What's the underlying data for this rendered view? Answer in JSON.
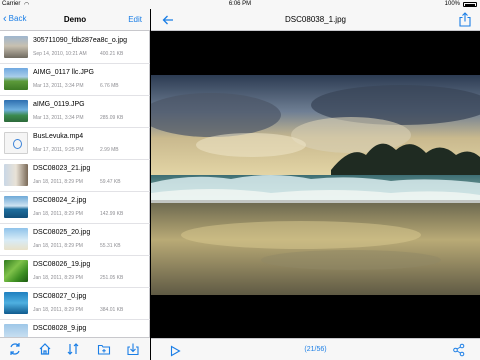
{
  "status": {
    "carrier": "Carrier",
    "time": "6:06 PM",
    "battery": "100%"
  },
  "left_nav": {
    "back_label": "Back",
    "title": "Demo",
    "edit_label": "Edit"
  },
  "files": [
    {
      "name": "305711090_fdb287ea8c_o.jpg",
      "date": "Sep 14, 2010, 10:21 AM",
      "size": "400.21 KB",
      "thumb": "photo-city"
    },
    {
      "name": "AIMG_0117 llc.JPG",
      "date": "Mar 13, 2011, 3:34 PM",
      "size": "6.76 MB",
      "thumb": "photo-field"
    },
    {
      "name": "aIMG_0119.JPG",
      "date": "Mar 13, 2011, 3:34 PM",
      "size": "285.09 KB",
      "thumb": "photo-lake"
    },
    {
      "name": "BusLevuka.mp4",
      "date": "Mar 17, 2011, 9:25 PM",
      "size": "2.99 MB",
      "thumb": "video-file"
    },
    {
      "name": "DSC08023_21.jpg",
      "date": "Jan 18, 2011, 8:29 PM",
      "size": "59.47 KB",
      "thumb": "photo-person"
    },
    {
      "name": "DSC08024_2.jpg",
      "date": "Jan 18, 2011, 8:29 PM",
      "size": "142.99 KB",
      "thumb": "photo-sea"
    },
    {
      "name": "DSC08025_20.jpg",
      "date": "Jan 18, 2011, 8:29 PM",
      "size": "55.31 KB",
      "thumb": "photo-beach"
    },
    {
      "name": "DSC08026_19.jpg",
      "date": "Jan 18, 2011, 8:29 PM",
      "size": "251.05 KB",
      "thumb": "photo-leaf"
    },
    {
      "name": "DSC08027_0.jpg",
      "date": "Jan 18, 2011, 8:29 PM",
      "size": "384.01 KB",
      "thumb": "photo-wave"
    },
    {
      "name": "DSC08028_9.jpg",
      "date": "",
      "size": "",
      "thumb": "photo-sky"
    }
  ],
  "left_toolbar": {
    "icons": [
      "sync-icon",
      "home-icon",
      "sort-icon",
      "new-folder-icon",
      "import-icon"
    ]
  },
  "right_nav": {
    "title": "DSC08038_1.jpg",
    "back_icon": "left-arrow-icon",
    "share_icon": "share-icon"
  },
  "right_toolbar": {
    "counter": "(21/56)",
    "play_icon": "play-icon",
    "settings_icon": "share-nodes-icon"
  },
  "colors": {
    "accent": "#1a7ee6",
    "bar": "#f7f7f7",
    "separator": "#c8c8cc"
  }
}
